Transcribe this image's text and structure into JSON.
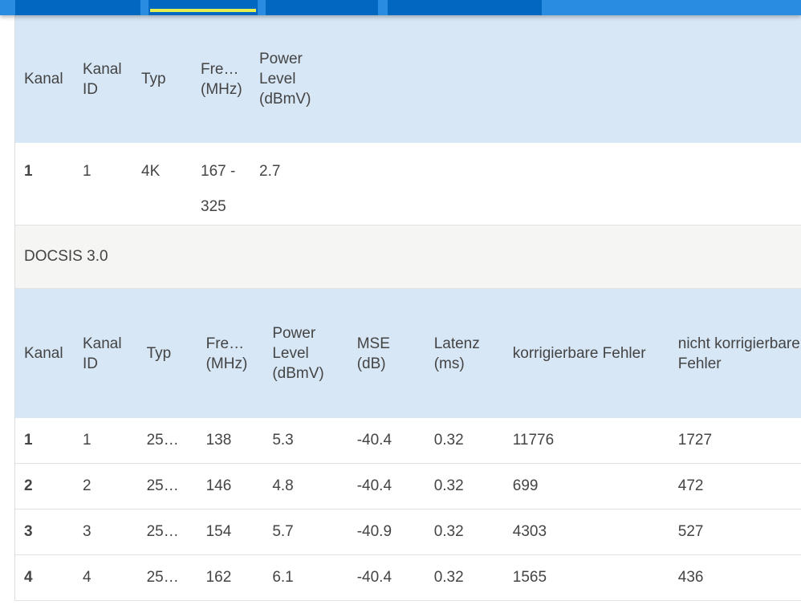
{
  "table1": {
    "headers": [
      "Kanal",
      "Kanal ID",
      "Typ",
      "Fre… (MHz)",
      "Power Level (dBmV)"
    ],
    "rows": [
      [
        "1",
        "1",
        "4K",
        "167 - 325",
        "2.7"
      ]
    ]
  },
  "section_title": "DOCSIS 3.0",
  "table2": {
    "headers": [
      "Kanal",
      "Kanal ID",
      "Typ",
      "Fre… (MHz)",
      "Power Level (dBmV)",
      "MSE (dB)",
      "Latenz (ms)",
      "korrigierbare Fehler",
      "nicht korrigierbare Fehler"
    ],
    "rows": [
      [
        "1",
        "1",
        "25…",
        "138",
        "5.3",
        "-40.4",
        "0.32",
        "11776",
        "1727"
      ],
      [
        "2",
        "2",
        "25…",
        "146",
        "4.8",
        "-40.4",
        "0.32",
        "699",
        "472"
      ],
      [
        "3",
        "3",
        "25…",
        "154",
        "5.7",
        "-40.9",
        "0.32",
        "4303",
        "527"
      ],
      [
        "4",
        "4",
        "25…",
        "162",
        "6.1",
        "-40.4",
        "0.32",
        "1565",
        "436"
      ]
    ]
  }
}
